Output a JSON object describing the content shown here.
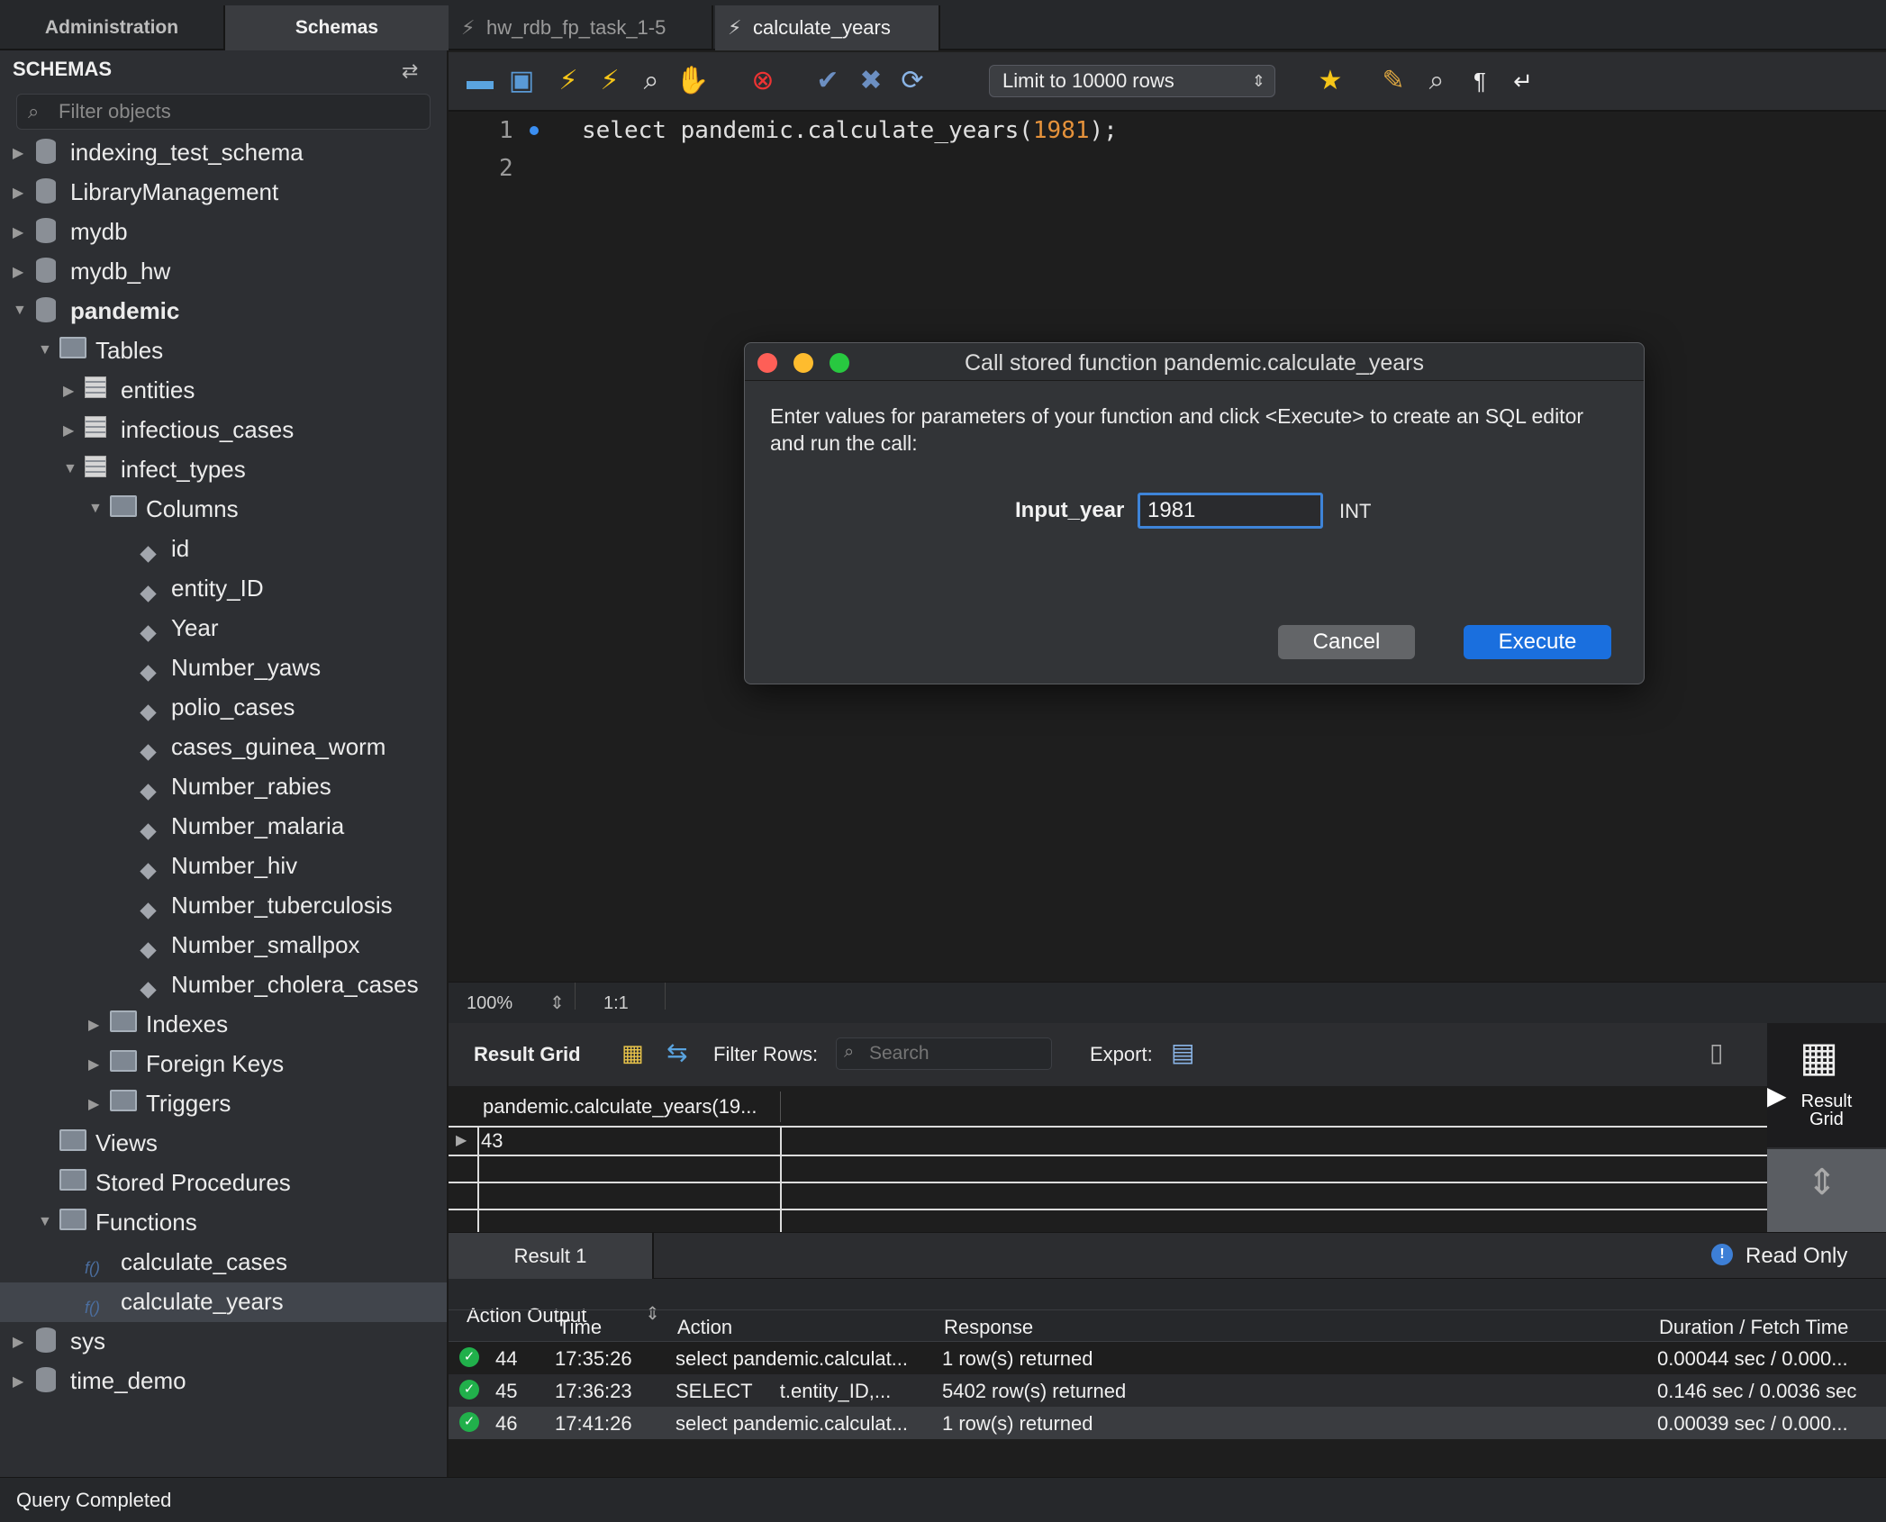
{
  "sidebar": {
    "tabs": [
      "Administration",
      "Schemas"
    ],
    "header": "SCHEMAS",
    "filter_placeholder": "Filter objects",
    "tree": [
      {
        "label": "indexing_test_schema"
      },
      {
        "label": "LibraryManagement"
      },
      {
        "label": "mydb"
      },
      {
        "label": "mydb_hw"
      },
      {
        "label": "pandemic"
      },
      {
        "label": "Tables"
      },
      {
        "label": "entities"
      },
      {
        "label": "infectious_cases"
      },
      {
        "label": "infect_types"
      },
      {
        "label": "Columns"
      },
      {
        "label": "id"
      },
      {
        "label": "entity_ID"
      },
      {
        "label": "Year"
      },
      {
        "label": "Number_yaws"
      },
      {
        "label": "polio_cases"
      },
      {
        "label": "cases_guinea_worm"
      },
      {
        "label": "Number_rabies"
      },
      {
        "label": "Number_malaria"
      },
      {
        "label": "Number_hiv"
      },
      {
        "label": "Number_tuberculosis"
      },
      {
        "label": "Number_smallpox"
      },
      {
        "label": "Number_cholera_cases"
      },
      {
        "label": "Indexes"
      },
      {
        "label": "Foreign Keys"
      },
      {
        "label": "Triggers"
      },
      {
        "label": "Views"
      },
      {
        "label": "Stored Procedures"
      },
      {
        "label": "Functions"
      },
      {
        "label": "calculate_cases"
      },
      {
        "label": "calculate_years"
      },
      {
        "label": "sys"
      },
      {
        "label": "time_demo"
      }
    ]
  },
  "editor_tabs": [
    "hw_rdb_fp_task_1-5",
    "calculate_years"
  ],
  "toolbar": {
    "limit_label": "Limit to 10000 rows"
  },
  "editor": {
    "line_numbers": [
      "1",
      "2"
    ],
    "code_prefix": "select pandemic.calculate_years(",
    "code_arg": "1981",
    "code_suffix": ");",
    "zoom": "100%",
    "position": "1:1"
  },
  "result": {
    "title": "Result Grid",
    "filter_label": "Filter Rows:",
    "search_placeholder": "Search",
    "export_label": "Export:",
    "column_header": "pandemic.calculate_years(19...",
    "rows": [
      [
        "43"
      ]
    ],
    "side_panel_label_1": "Result",
    "side_panel_label_2": "Grid",
    "tab": "Result 1",
    "read_only": "Read Only"
  },
  "output": {
    "title": "Action Output",
    "headers": [
      "Time",
      "Action",
      "Response",
      "Duration / Fetch Time"
    ],
    "rows": [
      {
        "num": "44",
        "time": "17:35:26",
        "action": "select pandemic.calculat...",
        "response": "1 row(s) returned",
        "duration": "0.00044 sec / 0.000..."
      },
      {
        "num": "45",
        "time": "17:36:23",
        "action": "SELECT     t.entity_ID,...",
        "response": "5402 row(s) returned",
        "duration": "0.146 sec / 0.0036 sec"
      },
      {
        "num": "46",
        "time": "17:41:26",
        "action": "select pandemic.calculat...",
        "response": "1 row(s) returned",
        "duration": "0.00039 sec / 0.000..."
      }
    ]
  },
  "dialog": {
    "title": "Call stored function pandemic.calculate_years",
    "description": "Enter values for parameters of your function and click <Execute> to create an SQL editor and run the call:",
    "param_label": "Input_year",
    "param_value": "1981",
    "param_type": "INT",
    "cancel_label": "Cancel",
    "execute_label": "Execute"
  },
  "status": "Query Completed",
  "colors": {
    "accent": "#1a6fde",
    "ok": "#21b04b",
    "number": "#e5923b"
  }
}
